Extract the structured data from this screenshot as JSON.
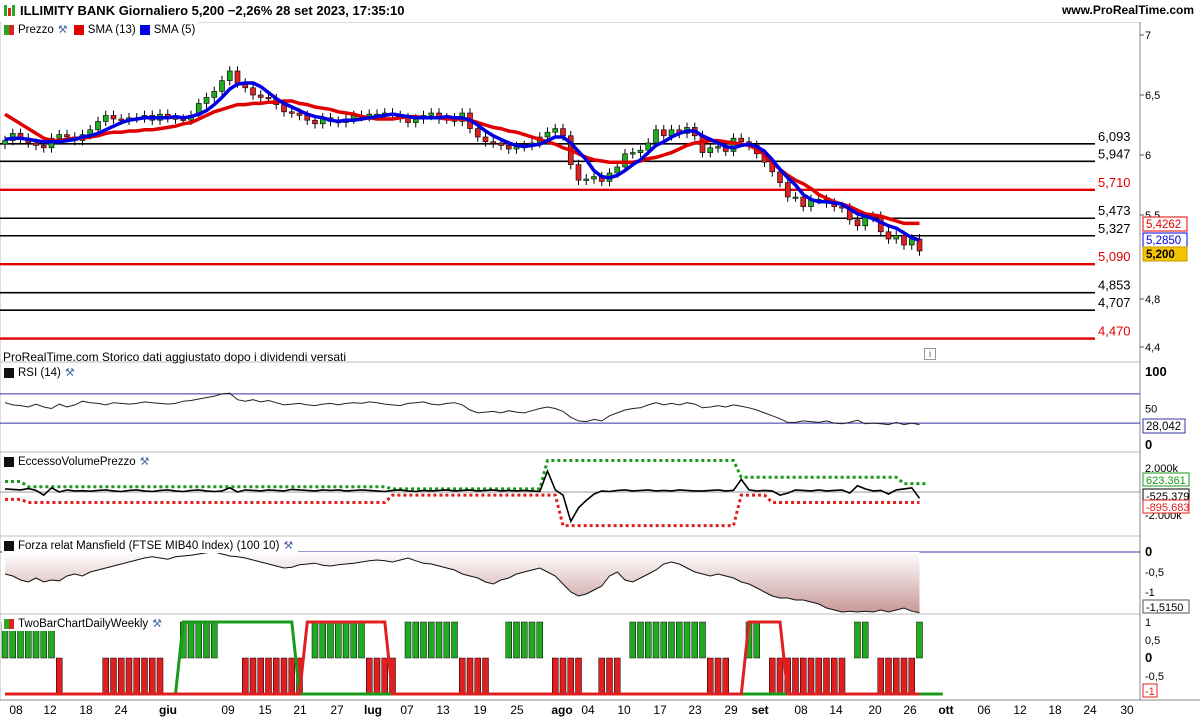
{
  "header": {
    "title": "ILLIMITY BANK Giornaliero 5,200 −2,26% 28 set 2023, 17:35:10",
    "site": "www.ProRealTime.com"
  },
  "note": "ProRealTime.com  Storico dati aggiustato dopo i dividendi versati",
  "colors": {
    "sma13": "#e00000",
    "sma5": "#0000e0",
    "up": "#22aa22",
    "down": "#dd2222",
    "support_red": "#e00000"
  },
  "panels": {
    "price": {
      "legend": [
        "Prezzo",
        "SMA (13)",
        "SMA (5)"
      ],
      "y_ticks": [
        "7",
        "6,5",
        "6",
        "5,5",
        "4,8",
        "4,4"
      ],
      "levels": [
        {
          "label": "6,093",
          "value": 6.093,
          "color": "#000000"
        },
        {
          "label": "5,947",
          "value": 5.947,
          "color": "#000000"
        },
        {
          "label": "5,710",
          "value": 5.71,
          "color": "#e00000"
        },
        {
          "label": "5,473",
          "value": 5.473,
          "color": "#000000"
        },
        {
          "label": "5,327",
          "value": 5.327,
          "color": "#000000"
        },
        {
          "label": "5,090",
          "value": 5.09,
          "color": "#e00000"
        },
        {
          "label": "4,853",
          "value": 4.853,
          "color": "#000000"
        },
        {
          "label": "4,707",
          "value": 4.707,
          "color": "#000000"
        },
        {
          "label": "4,470",
          "value": 4.47,
          "color": "#e00000"
        }
      ],
      "badges": [
        {
          "label": "5,4262",
          "value": 5.4262,
          "kind": "sma13"
        },
        {
          "label": "5,2850",
          "value": 5.285,
          "kind": "sma5"
        },
        {
          "label": "5,200",
          "value": 5.2,
          "kind": "last"
        }
      ]
    },
    "rsi": {
      "legend": "RSI (14)",
      "y_ticks": [
        "100",
        "50",
        "0"
      ],
      "value_label": "28,042"
    },
    "volume": {
      "legend": "EccessoVolumePrezzo",
      "y_ticks": [
        "2.000k",
        "-2.000k"
      ],
      "badges": [
        "623.361",
        "-525.379",
        "-895.683"
      ]
    },
    "mansfield": {
      "legend": "Forza relat Mansfield (FTSE MIB40 Index) (100 10)",
      "y_ticks": [
        "0",
        "-0,5",
        "-1"
      ],
      "value_label": "-1,5150"
    },
    "twobar": {
      "legend": "TwoBarChartDailyWeekly",
      "y_ticks": [
        "1",
        "0,5",
        "0",
        "-0,5"
      ],
      "value_label": "-1"
    }
  },
  "x_axis": [
    {
      "label": "08",
      "bold": false
    },
    {
      "label": "12",
      "bold": false
    },
    {
      "label": "18",
      "bold": false
    },
    {
      "label": "24",
      "bold": false
    },
    {
      "label": "giu",
      "bold": true
    },
    {
      "label": "09",
      "bold": false
    },
    {
      "label": "15",
      "bold": false
    },
    {
      "label": "21",
      "bold": false
    },
    {
      "label": "27",
      "bold": false
    },
    {
      "label": "lug",
      "bold": true
    },
    {
      "label": "07",
      "bold": false
    },
    {
      "label": "13",
      "bold": false
    },
    {
      "label": "19",
      "bold": false
    },
    {
      "label": "25",
      "bold": false
    },
    {
      "label": "ago",
      "bold": true
    },
    {
      "label": "04",
      "bold": false
    },
    {
      "label": "10",
      "bold": false
    },
    {
      "label": "17",
      "bold": false
    },
    {
      "label": "23",
      "bold": false
    },
    {
      "label": "29",
      "bold": false
    },
    {
      "label": "set",
      "bold": true
    },
    {
      "label": "08",
      "bold": false
    },
    {
      "label": "14",
      "bold": false
    },
    {
      "label": "20",
      "bold": false
    },
    {
      "label": "26",
      "bold": false
    },
    {
      "label": "ott",
      "bold": true
    },
    {
      "label": "06",
      "bold": false
    },
    {
      "label": "12",
      "bold": false
    },
    {
      "label": "18",
      "bold": false
    },
    {
      "label": "24",
      "bold": false
    },
    {
      "label": "30",
      "bold": false
    }
  ],
  "chart_data": {
    "type": "line",
    "title": "ILLIMITY BANK Giornaliero",
    "close": [
      6.12,
      6.18,
      6.14,
      6.1,
      6.08,
      6.06,
      6.14,
      6.17,
      6.15,
      6.12,
      6.17,
      6.21,
      6.28,
      6.33,
      6.3,
      6.29,
      6.31,
      6.31,
      6.33,
      6.29,
      6.34,
      6.31,
      6.3,
      6.29,
      6.33,
      6.43,
      6.48,
      6.53,
      6.62,
      6.7,
      6.6,
      6.56,
      6.5,
      6.48,
      6.47,
      6.42,
      6.36,
      6.35,
      6.33,
      6.29,
      6.26,
      6.31,
      6.28,
      6.27,
      6.3,
      6.33,
      6.32,
      6.34,
      6.34,
      6.35,
      6.33,
      6.31,
      6.27,
      6.3,
      6.33,
      6.35,
      6.3,
      6.31,
      6.28,
      6.35,
      6.22,
      6.15,
      6.11,
      6.1,
      6.08,
      6.05,
      6.07,
      6.08,
      6.1,
      6.15,
      6.19,
      6.22,
      6.16,
      5.92,
      5.79,
      5.8,
      5.82,
      5.78,
      5.85,
      5.9,
      6.01,
      6.02,
      6.04,
      6.1,
      6.21,
      6.16,
      6.21,
      6.18,
      6.23,
      6.16,
      6.02,
      6.06,
      6.07,
      6.03,
      6.14,
      6.11,
      6.08,
      6.01,
      5.94,
      5.86,
      5.77,
      5.65,
      5.65,
      5.57,
      5.63,
      5.63,
      5.6,
      5.57,
      5.56,
      5.46,
      5.41,
      5.48,
      5.49,
      5.36,
      5.3,
      5.33,
      5.25,
      5.3,
      5.2
    ],
    "sma13": [
      6.34,
      6.3,
      6.26,
      6.22,
      6.18,
      6.14,
      6.12,
      6.12,
      6.13,
      6.14,
      6.14,
      6.15,
      6.16,
      6.18,
      6.19,
      6.19,
      6.2,
      6.2,
      6.21,
      6.21,
      6.22,
      6.23,
      6.24,
      6.26,
      6.27,
      6.3,
      6.33,
      6.36,
      6.38,
      6.4,
      6.42,
      6.42,
      6.43,
      6.43,
      6.44,
      6.44,
      6.45,
      6.45,
      6.43,
      6.42,
      6.4,
      6.39,
      6.38,
      6.36,
      6.35,
      6.34,
      6.32,
      6.31,
      6.3,
      6.3,
      6.3,
      6.31,
      6.32,
      6.32,
      6.31,
      6.31,
      6.31,
      6.3,
      6.3,
      6.3,
      6.29,
      6.27,
      6.25,
      6.23,
      6.22,
      6.2,
      6.19,
      6.17,
      6.15,
      6.13,
      6.11,
      6.09,
      6.06,
      6.04,
      6.01,
      5.98,
      5.96,
      5.95,
      5.94,
      5.94,
      5.94,
      5.94,
      5.95,
      5.97,
      5.98,
      6.0,
      6.02,
      6.05,
      6.08,
      6.1,
      6.11,
      6.12,
      6.12,
      6.11,
      6.1,
      6.09,
      6.08,
      6.05,
      6.0,
      5.94,
      5.88,
      5.83,
      5.79,
      5.76,
      5.72,
      5.67,
      5.64,
      5.61,
      5.59,
      5.57,
      5.54,
      5.51,
      5.5,
      5.49,
      5.47,
      5.45,
      5.43,
      5.43,
      5.43
    ],
    "sma5": [
      6.13,
      6.14,
      6.14,
      6.13,
      6.12,
      6.11,
      6.11,
      6.11,
      6.12,
      6.13,
      6.15,
      6.16,
      6.18,
      6.21,
      6.24,
      6.27,
      6.29,
      6.3,
      6.31,
      6.31,
      6.31,
      6.31,
      6.32,
      6.31,
      6.32,
      6.34,
      6.37,
      6.42,
      6.48,
      6.55,
      6.59,
      6.6,
      6.6,
      6.57,
      6.52,
      6.47,
      6.43,
      6.4,
      6.37,
      6.34,
      6.32,
      6.31,
      6.29,
      6.28,
      6.29,
      6.29,
      6.3,
      6.31,
      6.32,
      6.33,
      6.34,
      6.33,
      6.32,
      6.31,
      6.31,
      6.31,
      6.31,
      6.32,
      6.31,
      6.31,
      6.29,
      6.25,
      6.2,
      6.16,
      6.13,
      6.1,
      6.08,
      6.07,
      6.08,
      6.09,
      6.12,
      6.15,
      6.15,
      6.1,
      6.03,
      5.96,
      5.87,
      5.82,
      5.81,
      5.83,
      5.87,
      5.92,
      5.96,
      6.02,
      6.08,
      6.11,
      6.15,
      6.18,
      6.2,
      6.2,
      6.16,
      6.13,
      6.1,
      6.07,
      6.06,
      6.08,
      6.09,
      6.07,
      6.03,
      5.96,
      5.88,
      5.81,
      5.75,
      5.67,
      5.63,
      5.61,
      5.61,
      5.6,
      5.59,
      5.55,
      5.51,
      5.49,
      5.47,
      5.44,
      5.41,
      5.39,
      5.35,
      5.31,
      5.29
    ],
    "rsi": [
      58,
      55,
      54,
      52,
      56,
      52,
      50,
      56,
      52,
      55,
      60,
      58,
      57,
      55,
      58,
      57,
      56,
      57,
      59,
      58,
      57,
      56,
      57,
      60,
      61,
      63,
      65,
      67,
      70,
      71,
      62,
      60,
      62,
      59,
      61,
      58,
      55,
      56,
      57,
      55,
      54,
      56,
      57,
      55,
      57,
      58,
      57,
      59,
      58,
      56,
      55,
      54,
      57,
      58,
      59,
      56,
      55,
      57,
      58,
      55,
      48,
      44,
      45,
      46,
      44,
      47,
      45,
      44,
      47,
      50,
      52,
      50,
      46,
      38,
      33,
      32,
      35,
      33,
      40,
      44,
      48,
      50,
      51,
      55,
      58,
      55,
      57,
      55,
      58,
      56,
      51,
      52,
      54,
      52,
      55,
      53,
      51,
      48,
      44,
      40,
      36,
      31,
      31,
      33,
      32,
      31,
      33,
      30,
      29,
      31,
      34,
      29,
      30,
      29,
      28,
      31,
      28,
      30,
      28
    ],
    "rsi_reference": [
      70,
      30
    ],
    "volume_black": [
      300,
      250,
      200,
      320,
      150,
      -300,
      400,
      0,
      200,
      100,
      120,
      80,
      150,
      200,
      100,
      50,
      150,
      200,
      100,
      50,
      150,
      200,
      100,
      50,
      150,
      200,
      100,
      50,
      100,
      400,
      0,
      200,
      150,
      100,
      200,
      150,
      100,
      250,
      200,
      150,
      100,
      200,
      150,
      200,
      100,
      150,
      200,
      150,
      100,
      50,
      150,
      200,
      100,
      50,
      150,
      100,
      150,
      200,
      100,
      150,
      200,
      100,
      150,
      200,
      100,
      150,
      100,
      150,
      100,
      50,
      2000,
      200,
      -300,
      -2800,
      -1500,
      -800,
      -200,
      100,
      50,
      150,
      200,
      100,
      150,
      200,
      100,
      150,
      100,
      200,
      150,
      100,
      100,
      150,
      200,
      100,
      150,
      1200,
      200,
      100,
      150,
      100,
      -300,
      -100,
      200,
      150,
      100,
      200,
      100,
      150,
      200,
      -100,
      600,
      300,
      100,
      150,
      -200,
      200,
      300,
      400,
      -600
    ],
    "volume_upper": [
      1000,
      1000,
      1000,
      500,
      500,
      500,
      500,
      500,
      500,
      500,
      500,
      500,
      500,
      500,
      500,
      500,
      500,
      500,
      500,
      500,
      500,
      500,
      500,
      500,
      500,
      500,
      500,
      500,
      500,
      500,
      500,
      500,
      500,
      500,
      500,
      500,
      500,
      500,
      500,
      500,
      500,
      500,
      500,
      500,
      500,
      500,
      500,
      500,
      500,
      500,
      300,
      300,
      300,
      300,
      300,
      300,
      300,
      300,
      300,
      300,
      300,
      300,
      300,
      300,
      300,
      300,
      300,
      300,
      300,
      300,
      3000,
      3000,
      3000,
      3000,
      3000,
      3000,
      3000,
      3000,
      3000,
      3000,
      3000,
      3000,
      3000,
      3000,
      3000,
      3000,
      3000,
      3000,
      3000,
      3000,
      3000,
      3000,
      3000,
      3000,
      3000,
      1400,
      1400,
      1400,
      1400,
      1400,
      1400,
      1400,
      1400,
      1400,
      1400,
      1400,
      1400,
      1400,
      1400,
      1400,
      1400,
      1400,
      1400,
      1400,
      1400,
      1400,
      800,
      800,
      800,
      800
    ],
    "volume_lower": [
      -700,
      -700,
      -700,
      -1000,
      -1000,
      -1000,
      -1000,
      -1000,
      -1000,
      -1000,
      -1000,
      -1000,
      -1000,
      -1000,
      -1000,
      -1000,
      -1000,
      -1000,
      -1000,
      -1000,
      -1000,
      -1000,
      -1000,
      -1000,
      -1000,
      -1000,
      -1000,
      -1000,
      -1000,
      -1000,
      -1000,
      -1000,
      -1000,
      -1000,
      -1000,
      -1000,
      -1000,
      -1000,
      -1000,
      -1000,
      -1000,
      -1000,
      -1000,
      -1000,
      -1000,
      -1000,
      -1000,
      -1000,
      -1000,
      -1000,
      -300,
      -300,
      -300,
      -300,
      -300,
      -300,
      -300,
      -300,
      -300,
      -300,
      -300,
      -300,
      -300,
      -300,
      -300,
      -300,
      -300,
      -300,
      -300,
      -300,
      -300,
      -300,
      -3200,
      -3200,
      -3200,
      -3200,
      -3200,
      -3200,
      -3200,
      -3200,
      -3200,
      -3200,
      -3200,
      -3200,
      -3200,
      -3200,
      -3200,
      -3200,
      -3200,
      -3200,
      -3200,
      -3200,
      -3200,
      -3200,
      -3200,
      -300,
      -300,
      -300,
      -300,
      -1000,
      -1000,
      -1000,
      -1000,
      -1000,
      -1000,
      -1000,
      -1000,
      -1000,
      -1000,
      -1000,
      -1000,
      -1000,
      -1000,
      -1000,
      -1000,
      -1000,
      -1000,
      -1000,
      -1000
    ],
    "mansfield": [
      -0.55,
      -0.6,
      -0.7,
      -0.75,
      -0.65,
      -0.75,
      -0.7,
      -0.72,
      -0.6,
      -0.55,
      -0.6,
      -0.5,
      -0.45,
      -0.4,
      -0.35,
      -0.3,
      -0.25,
      -0.2,
      -0.15,
      -0.12,
      -0.15,
      -0.18,
      -0.12,
      -0.1,
      -0.08,
      -0.05,
      -0.02,
      0.0,
      -0.05,
      -0.1,
      -0.12,
      -0.15,
      -0.2,
      -0.25,
      -0.3,
      -0.35,
      -0.4,
      -0.38,
      -0.32,
      -0.3,
      -0.28,
      -0.33,
      -0.35,
      -0.32,
      -0.3,
      -0.28,
      -0.25,
      -0.22,
      -0.2,
      -0.22,
      -0.25,
      -0.2,
      -0.15,
      -0.22,
      -0.28,
      -0.3,
      -0.35,
      -0.4,
      -0.45,
      -0.55,
      -0.6,
      -0.65,
      -0.75,
      -0.8,
      -0.7,
      -0.65,
      -0.55,
      -0.5,
      -0.45,
      -0.4,
      -0.5,
      -0.6,
      -0.8,
      -1.0,
      -1.1,
      -1.05,
      -0.95,
      -0.85,
      -0.6,
      -0.5,
      -0.7,
      -0.75,
      -0.65,
      -0.55,
      -0.45,
      -0.3,
      -0.25,
      -0.3,
      -0.4,
      -0.5,
      -0.55,
      -0.6,
      -0.55,
      -0.6,
      -0.65,
      -0.75,
      -0.8,
      -0.9,
      -1.0,
      -1.1,
      -1.15,
      -1.15,
      -1.2,
      -1.2,
      -1.25,
      -1.3,
      -1.4,
      -1.45,
      -1.5,
      -1.48,
      -1.5,
      -1.48,
      -1.5,
      -1.45,
      -1.5,
      -1.45,
      -1.4,
      -1.48,
      -1.52
    ],
    "twobar_bars": [
      1,
      1,
      1,
      1,
      1,
      1,
      1,
      -1,
      0,
      0,
      0,
      0,
      0,
      -1,
      -1,
      -1,
      -1,
      -1,
      -1,
      -1,
      -1,
      0,
      0,
      1,
      1,
      1,
      1,
      1,
      0,
      0,
      0,
      -1,
      -1,
      -1,
      -1,
      -1,
      -1,
      -1,
      -1,
      0,
      1,
      1,
      1,
      1,
      1,
      1,
      1,
      -1,
      -1,
      -1,
      -1,
      0,
      1,
      1,
      1,
      1,
      1,
      1,
      1,
      -1,
      -1,
      -1,
      -1,
      0,
      0,
      1,
      1,
      1,
      1,
      1,
      0,
      -1,
      -1,
      -1,
      -1,
      0,
      0,
      -1,
      -1,
      -1,
      0,
      1,
      1,
      1,
      1,
      1,
      1,
      1,
      1,
      1,
      1,
      -1,
      -1,
      -1,
      0,
      0,
      1,
      1,
      0,
      -1,
      -1,
      -1,
      -1,
      -1,
      -1,
      -1,
      -1,
      -1,
      -1,
      0,
      1,
      1,
      0,
      -1,
      -1,
      -1,
      -1,
      -1,
      1,
      -1
    ],
    "twobar_red_line": [
      -1,
      -1,
      -1,
      -1,
      -1,
      -1,
      -1,
      -1,
      -1,
      -1,
      -1,
      -1,
      -1,
      -1,
      -1,
      -1,
      -1,
      -1,
      -1,
      -1,
      -1,
      -1,
      -1,
      -1,
      -1,
      -1,
      -1,
      -1,
      -1,
      -1,
      -1,
      -1,
      -1,
      -1,
      -1,
      -1,
      -1,
      -1,
      -1,
      1,
      1,
      1,
      1,
      1,
      1,
      1,
      1,
      1,
      1,
      1,
      -1,
      -1,
      -1,
      -1,
      -1,
      -1,
      -1,
      -1,
      -1,
      -1,
      -1,
      -1,
      -1,
      -1,
      -1,
      -1,
      -1,
      -1,
      -1,
      -1,
      -1,
      -1,
      -1,
      -1,
      -1,
      -1,
      -1,
      -1,
      -1,
      -1,
      -1,
      -1,
      -1,
      -1,
      -1,
      -1,
      -1,
      -1,
      -1,
      -1,
      -1,
      -1,
      -1,
      -1,
      -1,
      -1,
      1,
      1,
      1,
      1,
      1,
      -1,
      -1,
      -1,
      -1,
      -1,
      -1,
      -1,
      -1,
      -1,
      -1,
      -1,
      -1,
      -1,
      -1,
      -1,
      -1,
      -1,
      -1
    ],
    "twobar_green_line": [
      -1,
      -1,
      -1,
      -1,
      -1,
      -1,
      -1,
      -1,
      -1,
      -1,
      -1,
      -1,
      -1,
      -1,
      -1,
      -1,
      -1,
      -1,
      -1,
      -1,
      -1,
      -1,
      -1,
      1,
      1,
      1,
      1,
      1,
      1,
      1,
      1,
      1,
      1,
      1,
      1,
      1,
      1,
      1,
      -1,
      -1,
      -1,
      -1,
      -1,
      -1,
      -1,
      -1,
      -1,
      -1,
      -1,
      -1,
      -1,
      -1,
      -1,
      -1,
      -1,
      -1,
      -1,
      -1,
      -1,
      -1,
      -1,
      -1,
      -1,
      -1,
      -1,
      -1,
      -1,
      -1,
      -1,
      -1,
      -1,
      -1,
      -1,
      -1,
      -1,
      -1,
      -1,
      -1,
      -1,
      -1,
      -1,
      -1,
      -1,
      -1,
      -1,
      -1,
      -1,
      -1,
      -1,
      -1,
      -1,
      -1,
      -1,
      -1,
      -1,
      -1,
      -1,
      -1,
      -1,
      -1,
      -1,
      -1,
      -1,
      -1,
      -1,
      -1,
      -1,
      -1,
      -1,
      -1,
      -1,
      -1,
      -1,
      -1,
      -1,
      -1,
      -1,
      -1,
      -1,
      -1,
      -1,
      -1
    ]
  }
}
